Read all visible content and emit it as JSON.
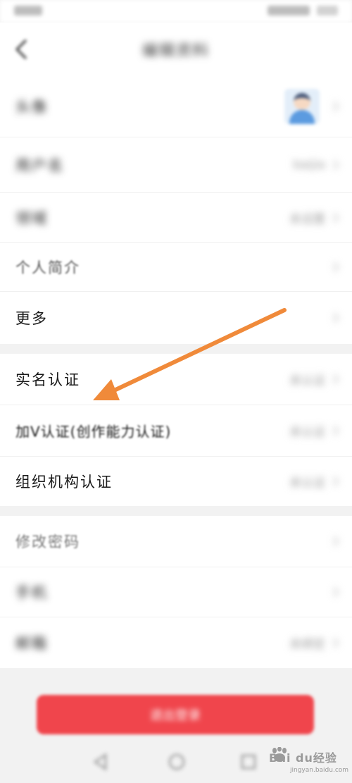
{
  "nav": {
    "title": "编辑资料"
  },
  "rows": [
    {
      "id": "avatar",
      "label": "头像",
      "value": ""
    },
    {
      "id": "username",
      "label": "用户名",
      "value": "baijia"
    },
    {
      "id": "domain",
      "label": "领域",
      "value": "未设置"
    },
    {
      "id": "bio",
      "label": "个人简介",
      "value": ""
    },
    {
      "id": "more",
      "label": "更多",
      "value": ""
    },
    {
      "id": "realname",
      "label": "实名认证",
      "value": "未认证"
    },
    {
      "id": "vcert",
      "label": "加V认证(创作能力认证)",
      "value": "未认证"
    },
    {
      "id": "orgcert",
      "label": "组织机构认证",
      "value": "未认证"
    },
    {
      "id": "password",
      "label": "修改密码",
      "value": ""
    },
    {
      "id": "phone",
      "label": "手机",
      "value": ""
    },
    {
      "id": "email",
      "label": "邮箱",
      "value": "未绑定"
    }
  ],
  "logout": {
    "label": "退出登录"
  },
  "watermark": {
    "text": "Bai du经验",
    "url": "jingyan.baidu.com"
  },
  "colors": {
    "accent": "#f0454c",
    "arrow": "#f08a3a",
    "background": "#f2f2f2"
  }
}
